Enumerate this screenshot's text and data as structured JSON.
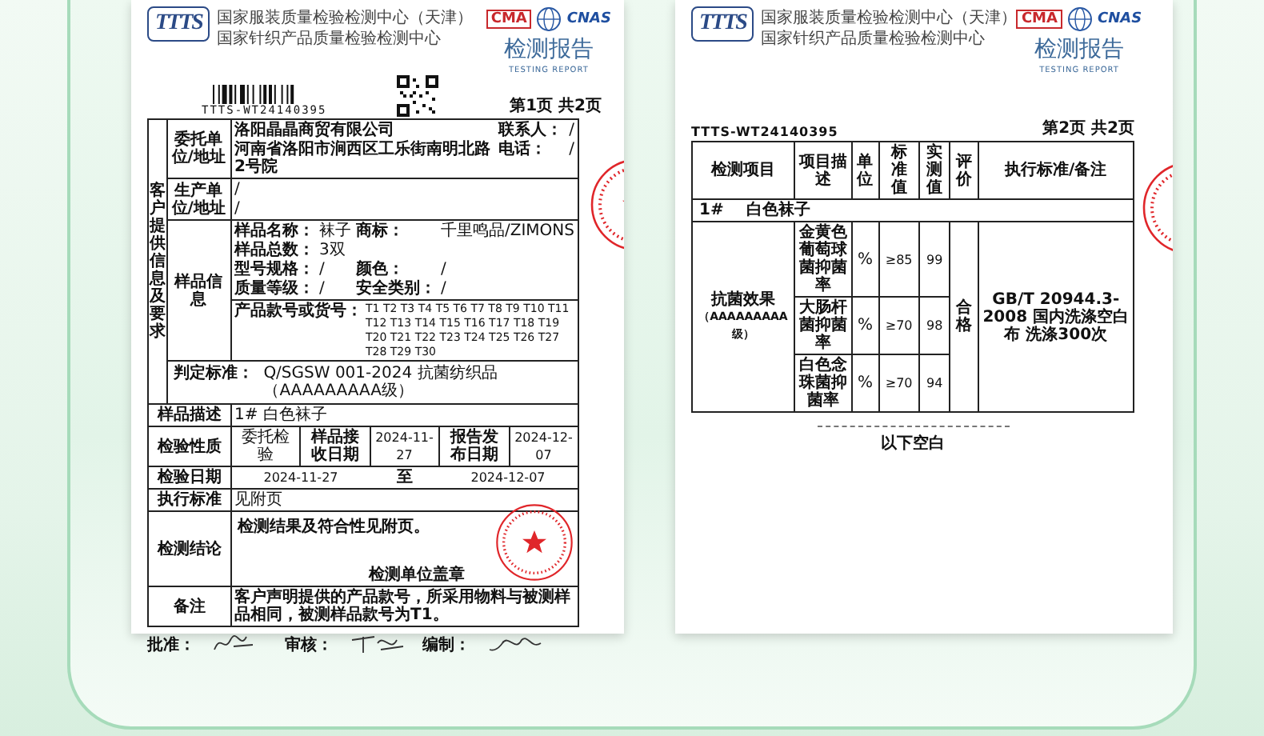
{
  "report_page_1": {
    "header": {
      "logo": "TTTS",
      "org_lines": [
        "国家服装质量检验检测中心（天津）",
        "国家针织产品质量检验检测中心"
      ],
      "marks": [
        "CMA",
        "CNAS"
      ],
      "title": "检测报告",
      "subtitle": "TESTING REPORT"
    },
    "report_number": "TTTS-WT24140395",
    "page_label": "第1页 共2页",
    "side_label": "客户提供信息及要求",
    "client": {
      "label": "委托单位/地址",
      "name": "洛阳晶晶商贸有限公司",
      "address": "河南省洛阳市涧西区工乐街南明北路2号院",
      "contact_label": "联系人：",
      "contact": "/",
      "phone_label": "电话：",
      "phone": "/"
    },
    "manufacturer": {
      "label": "生产单位/地址",
      "lines": [
        "/",
        "/"
      ]
    },
    "sample_info": {
      "label": "样品信息",
      "field_lines": [
        [
          {
            "label": "样品名称：",
            "value": "袜子"
          },
          {
            "label": "商标：",
            "value": "千里鸣品/ZIMONS"
          }
        ],
        [
          {
            "label": "样品总数：",
            "value": "3双"
          }
        ],
        [
          {
            "label": "型号规格：",
            "value": "/"
          },
          {
            "label": "颜色：",
            "value": "/"
          }
        ],
        [
          {
            "label": "质量等级：",
            "value": "/"
          },
          {
            "label": "安全类别：",
            "value": "/"
          }
        ]
      ],
      "codes_label": "产品款号或货号：",
      "codes": "T1 T2 T3 T4 T5 T6 T7 T8 T9 T10 T11 T12 T13 T14 T15 T16 T17 T18 T19 T20 T21 T22 T23 T24 T25 T26 T27 T28 T29 T30"
    },
    "judgement": {
      "label": "判定标准：",
      "value": "Q/SGSW 001-2024 抗菌纺织品（AAAAAAAAA级）"
    },
    "description": {
      "label": "样品描述",
      "value": "1# 白色袜子"
    },
    "inspection": {
      "label": "检验性质",
      "type": "委托检验",
      "received_label": "样品接收日期",
      "received": "2024-11-27",
      "issued_label": "报告发布日期",
      "issued": "2024-12-07"
    },
    "test_dates": {
      "label": "检验日期",
      "from": "2024-11-27",
      "to_word": "至",
      "to": "2024-12-07"
    },
    "standard": {
      "label": "执行标准",
      "value": "见附页"
    },
    "conclusion": {
      "label": "检测结论",
      "text": "检测结果及符合性见附页。",
      "seal_note": "检测单位盖章"
    },
    "remarks": {
      "label": "备注",
      "text": "客户声明提供的产品款号，所采用物料与被测样品相同，被测样品款号为T1。"
    },
    "signatures": [
      {
        "label": "批准："
      },
      {
        "label": "审核："
      },
      {
        "label": "编制："
      }
    ]
  },
  "report_page_2": {
    "header": {
      "logo": "TTTS",
      "org_lines": [
        "国家服装质量检验检测中心（天津）",
        "国家针织产品质量检验检测中心"
      ],
      "marks": [
        "CMA",
        "CNAS"
      ],
      "title": "检测报告",
      "subtitle": "TESTING REPORT"
    },
    "report_number": "TTTS-WT24140395",
    "page_label": "第2页 共2页",
    "columns": [
      "检测项目",
      "项目描述",
      "单位",
      "标准值",
      "实测值",
      "评价",
      "执行标准/备注"
    ],
    "sample_row": {
      "number": "1#",
      "name": "白色袜子"
    },
    "group": {
      "name": "抗菌效果",
      "grade": "（AAAAAAAAA级）",
      "evaluation": "合格",
      "standard": "GB/T 20944.3-2008 国内洗涤空白布 洗涤300次"
    },
    "rows": [
      {
        "item": "金黄色葡萄球菌抑菌率",
        "unit": "%",
        "requirement": "≥85",
        "result": "99"
      },
      {
        "item": "大肠杆菌抑菌率",
        "unit": "%",
        "requirement": "≥70",
        "result": "98"
      },
      {
        "item": "白色念珠菌抑菌率",
        "unit": "%",
        "requirement": "≥70",
        "result": "94"
      }
    ],
    "end_note": "以下空白"
  }
}
